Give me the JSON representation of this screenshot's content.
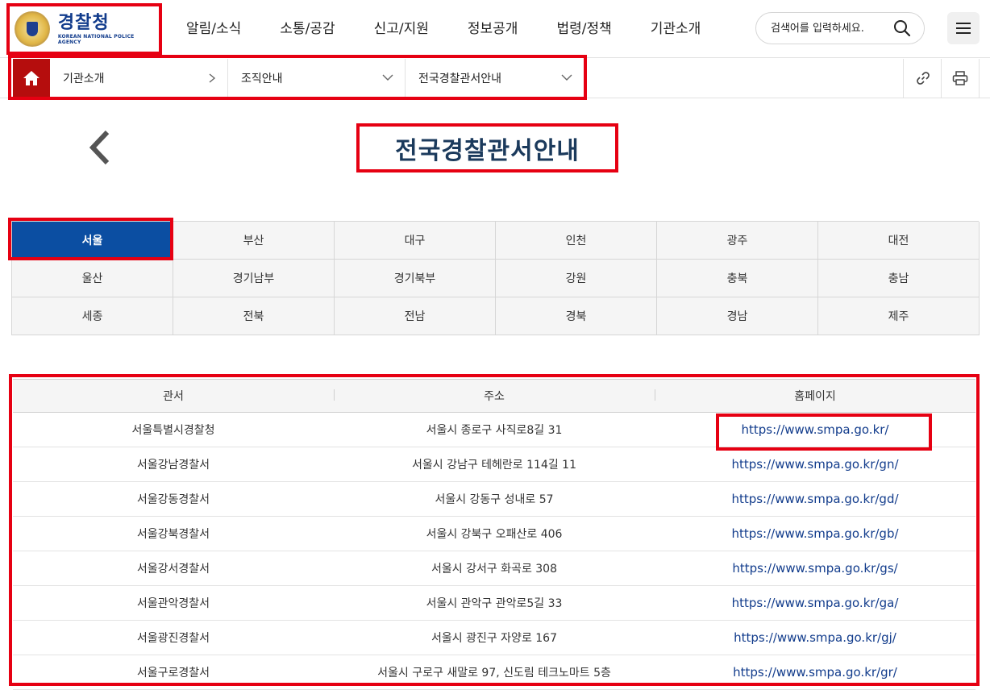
{
  "header": {
    "logo_title": "경찰청",
    "logo_sub": "KOREAN NATIONAL POLICE AGENCY",
    "nav": [
      "알림/소식",
      "소통/공감",
      "신고/지원",
      "정보공개",
      "법령/정책",
      "기관소개"
    ],
    "search_placeholder": "검색어를 입력하세요."
  },
  "breadcrumb": [
    "기관소개",
    "조직안내",
    "전국경찰관서안내"
  ],
  "page_title": "전국경찰관서안내",
  "regions": {
    "active": "서울",
    "items": [
      "서울",
      "부산",
      "대구",
      "인천",
      "광주",
      "대전",
      "울산",
      "경기남부",
      "경기북부",
      "강원",
      "충북",
      "충남",
      "세종",
      "전북",
      "전남",
      "경북",
      "경남",
      "제주"
    ]
  },
  "table": {
    "headers": [
      "관서",
      "주소",
      "홈페이지"
    ],
    "rows": [
      [
        "서울특별시경찰청",
        "서울시 종로구 사직로8길 31",
        "https://www.smpa.go.kr/"
      ],
      [
        "서울강남경찰서",
        "서울시 강남구 테헤란로 114길 11",
        "https://www.smpa.go.kr/gn/"
      ],
      [
        "서울강동경찰서",
        "서울시 강동구 성내로 57",
        "https://www.smpa.go.kr/gd/"
      ],
      [
        "서울강북경찰서",
        "서울시 강북구 오패산로 406",
        "https://www.smpa.go.kr/gb/"
      ],
      [
        "서울강서경찰서",
        "서울시 강서구 화곡로 308",
        "https://www.smpa.go.kr/gs/"
      ],
      [
        "서울관악경찰서",
        "서울시 관악구 관악로5길 33",
        "https://www.smpa.go.kr/ga/"
      ],
      [
        "서울광진경찰서",
        "서울시 광진구 자양로 167",
        "https://www.smpa.go.kr/gj/"
      ],
      [
        "서울구로경찰서",
        "서울시 구로구 새말로 97, 신도림 테크노마트 5층",
        "https://www.smpa.go.kr/gr/"
      ]
    ]
  },
  "colors": {
    "highlight_border": "#e60012",
    "active_tab": "#0b4ea2",
    "home": "#b50d0d",
    "link": "#123c8c"
  },
  "icons": {
    "home": "home-icon",
    "link": "link-icon",
    "print": "print-icon",
    "search": "search-icon",
    "menu": "hamburger-menu-icon",
    "back": "chevron-left-icon"
  }
}
